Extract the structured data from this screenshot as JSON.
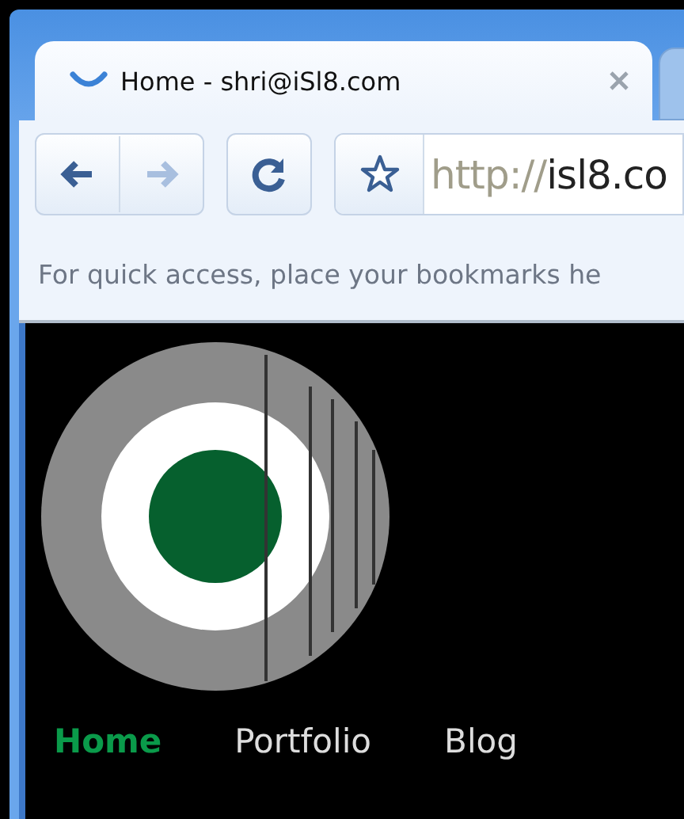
{
  "tab": {
    "title": "Home - shri@iSl8.com",
    "selected": true
  },
  "address_bar": {
    "scheme": "http://",
    "host": "isl8.co"
  },
  "toolbar": {
    "forward_disabled": true
  },
  "bookmarks_bar": {
    "hint": "For quick access, place your bookmarks he"
  },
  "nav": [
    {
      "label": "Home",
      "selected": true
    },
    {
      "label": "Portfolio",
      "selected": false
    },
    {
      "label": "Blog",
      "selected": false
    }
  ]
}
